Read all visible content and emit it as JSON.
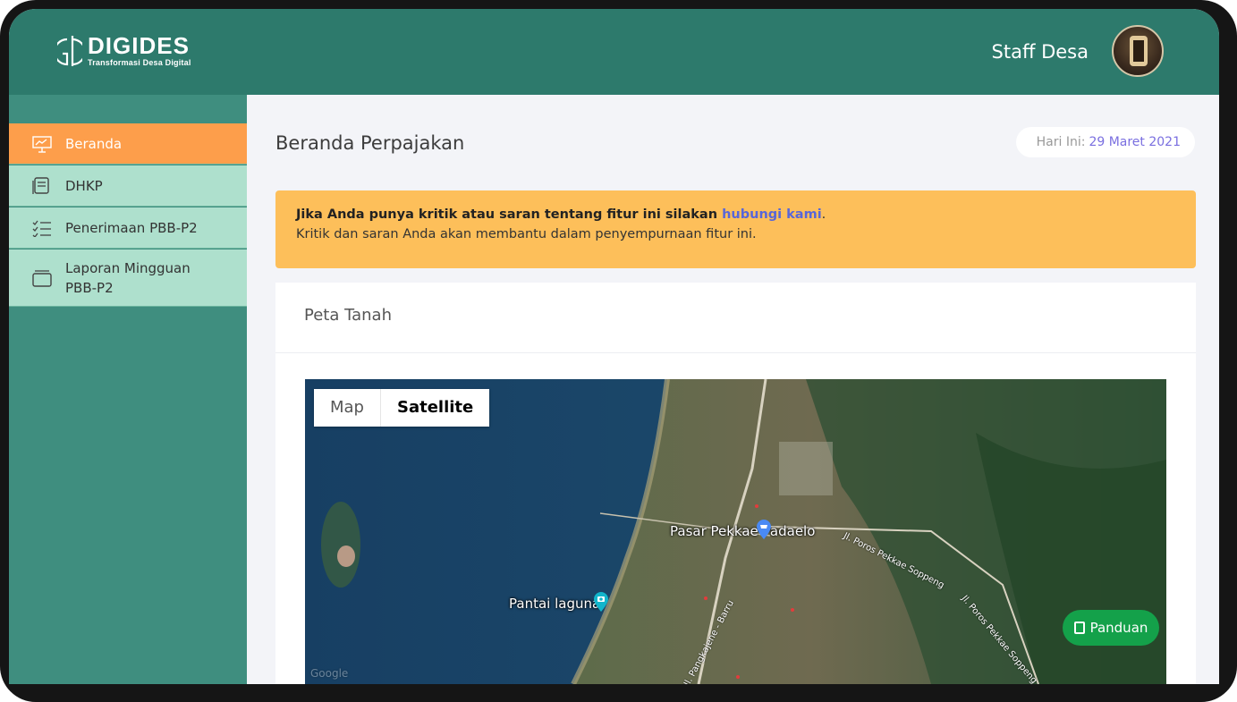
{
  "brand": {
    "name": "DIGIDES",
    "tagline": "Transformasi Desa Digital"
  },
  "user": {
    "name": "Staff Desa"
  },
  "sidebar": {
    "items": [
      {
        "label": "Beranda",
        "icon": "presentation-chart-icon",
        "active": true
      },
      {
        "label": "DHKP",
        "icon": "document-stack-icon",
        "active": false
      },
      {
        "label": "Penerimaan PBB-P2",
        "icon": "checklist-icon",
        "active": false
      },
      {
        "label": "Laporan Mingguan PBB-P2",
        "icon": "folder-icon",
        "active": false
      }
    ]
  },
  "main": {
    "title": "Beranda Perpajakan",
    "date_label": "Hari Ini:",
    "date_value": "29 Maret 2021",
    "alert": {
      "line1_prefix": "Jika Anda punya kritik atau saran tentang fitur ini silakan ",
      "line1_link": "hubungi kami",
      "line1_suffix": ".",
      "line2": "Kritik dan saran Anda akan membantu dalam penyempurnaan fitur ini."
    },
    "card": {
      "title": "Peta Tanah",
      "map": {
        "type_buttons": [
          "Map",
          "Satellite"
        ],
        "selected_type": "Satellite",
        "places": [
          {
            "name": "Pasar Pekkae Padaelo",
            "icon": "shopping-cart-pin-icon"
          },
          {
            "name": "Pantai laguna",
            "icon": "camera-pin-icon"
          }
        ],
        "roads": [
          "Jl. Poros Pekkae Soppeng",
          "Jl. Poros Pekkae Soppeng",
          "Jl. Pangkajene - Barru"
        ],
        "attribution": "Google"
      }
    }
  },
  "help_button": {
    "label": "Panduan",
    "icon": "book-icon"
  },
  "colors": {
    "header": "#2d7a6c",
    "sidebar": "#3f8e7f",
    "sidebar_item": "#aee0cd",
    "active": "#fd9e4b",
    "alert": "#fdbf5a",
    "help": "#14a14a"
  }
}
